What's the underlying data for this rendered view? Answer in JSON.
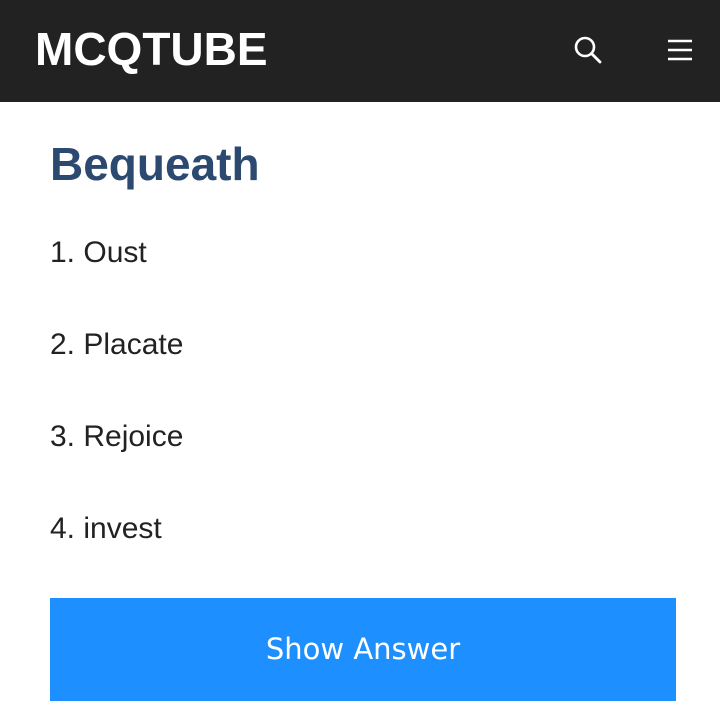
{
  "header": {
    "logo_text": "MCQTUBE",
    "search_icon": "search-icon",
    "menu_icon": "hamburger-menu-icon",
    "background_color": "#222222"
  },
  "question": {
    "title": "Bequeath",
    "title_color": "#2c4a70",
    "options": [
      {
        "label": "1. Oust"
      },
      {
        "label": "2. Placate"
      },
      {
        "label": "3. Rejoice"
      },
      {
        "label": "4. invest"
      }
    ]
  },
  "actions": {
    "show_answer_label": "Show Answer",
    "button_color": "#1e8fff"
  }
}
